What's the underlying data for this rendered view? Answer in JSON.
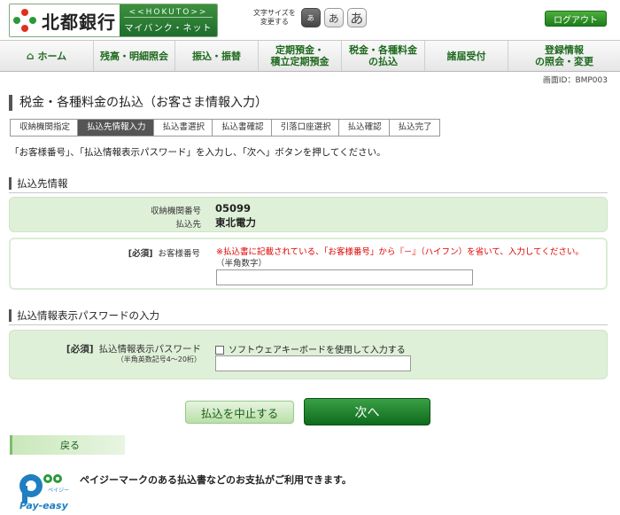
{
  "header": {
    "logo_text": "北都銀行",
    "logo_sub_top": "<<HOKUTO>>",
    "logo_sub": "マイバンク・ネット",
    "fontsize_label_1": "文字サイズを",
    "fontsize_label_2": "変更する",
    "fontsize_buttons": [
      "あ",
      "あ",
      "あ"
    ],
    "logout": "ログアウト"
  },
  "nav": {
    "items": [
      {
        "label": "ホーム",
        "icon": "home-icon"
      },
      {
        "label": "残高・明細照会"
      },
      {
        "label": "振込・振替"
      },
      {
        "label_1": "定期預金・",
        "label_2": "積立定期預金"
      },
      {
        "label_1": "税金・各種料金",
        "label_2": "の払込"
      },
      {
        "label": "諸届受付"
      },
      {
        "label_1": "登録情報",
        "label_2": "の照会・変更"
      }
    ]
  },
  "screen_id": "画面ID：BMP003",
  "page_title": "税金・各種料金の払込（お客さま情報入力）",
  "steps": [
    "収納機関指定",
    "払込先情報入力",
    "払込書選択",
    "払込書確認",
    "引落口座選択",
    "払込確認",
    "払込完了"
  ],
  "active_step_index": 1,
  "instruction": "「お客様番号」、「払込情報表示パスワード」を入力し、「次へ」ボタンを押してください。",
  "payee_section": {
    "heading": "払込先情報",
    "agency_label": "収納機関番号",
    "agency_value": "05099",
    "payee_label": "払込先",
    "payee_value": "東北電力"
  },
  "customer_number": {
    "required": "[必須]",
    "label": "お客様番号",
    "warning": "※払込書に記載されている、「お客様番号」から『－』（ハイフン）を省いて、入力してください。",
    "hint": "（半角数字）",
    "value": ""
  },
  "password_section": {
    "heading": "払込情報表示パスワードの入力",
    "required": "[必須]",
    "label": "払込情報表示パスワード",
    "sub_label": "（半角英数記号4～20桁）",
    "checkbox_label": "ソフトウェアキーボードを使用して入力する",
    "value": ""
  },
  "buttons": {
    "cancel": "払込を中止する",
    "next": "次へ",
    "back": "戻る"
  },
  "payeasy": {
    "logo_small": "ペイジー",
    "logo_text": "Pay-easy",
    "message": "ペイジーマークのある払込書などのお支払がご利用できます。"
  },
  "colors": {
    "brand_green": "#1c7d1c",
    "panel_green": "#dff0d8",
    "warning_red": "#e00000",
    "active_step": "#555555"
  }
}
